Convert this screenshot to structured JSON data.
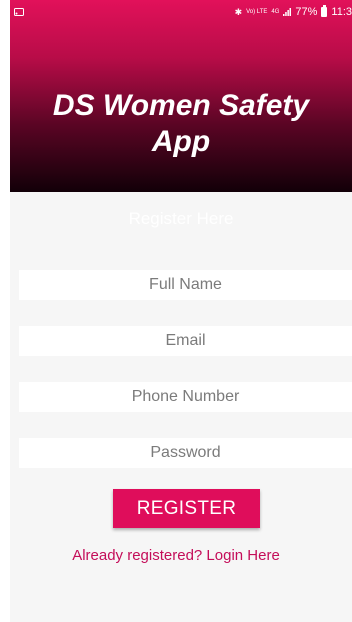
{
  "status_bar": {
    "volte_label": "Vo) LTE",
    "network_label": "4G",
    "battery_percent": "77%",
    "time": "11:3"
  },
  "header": {
    "title": "DS Women Safety\nApp"
  },
  "form": {
    "heading": "Register Here",
    "full_name_placeholder": "Full Name",
    "email_placeholder": "Email",
    "phone_placeholder": "Phone Number",
    "password_placeholder": "Password",
    "register_label": "REGISTER",
    "login_link_label": "Already registered? Login Here"
  },
  "colors": {
    "header_gradient_top": "#e2115a",
    "header_gradient_bottom": "#120008",
    "accent": "#df0d5b",
    "link": "#c40d59",
    "background": "#f6f6f6"
  }
}
